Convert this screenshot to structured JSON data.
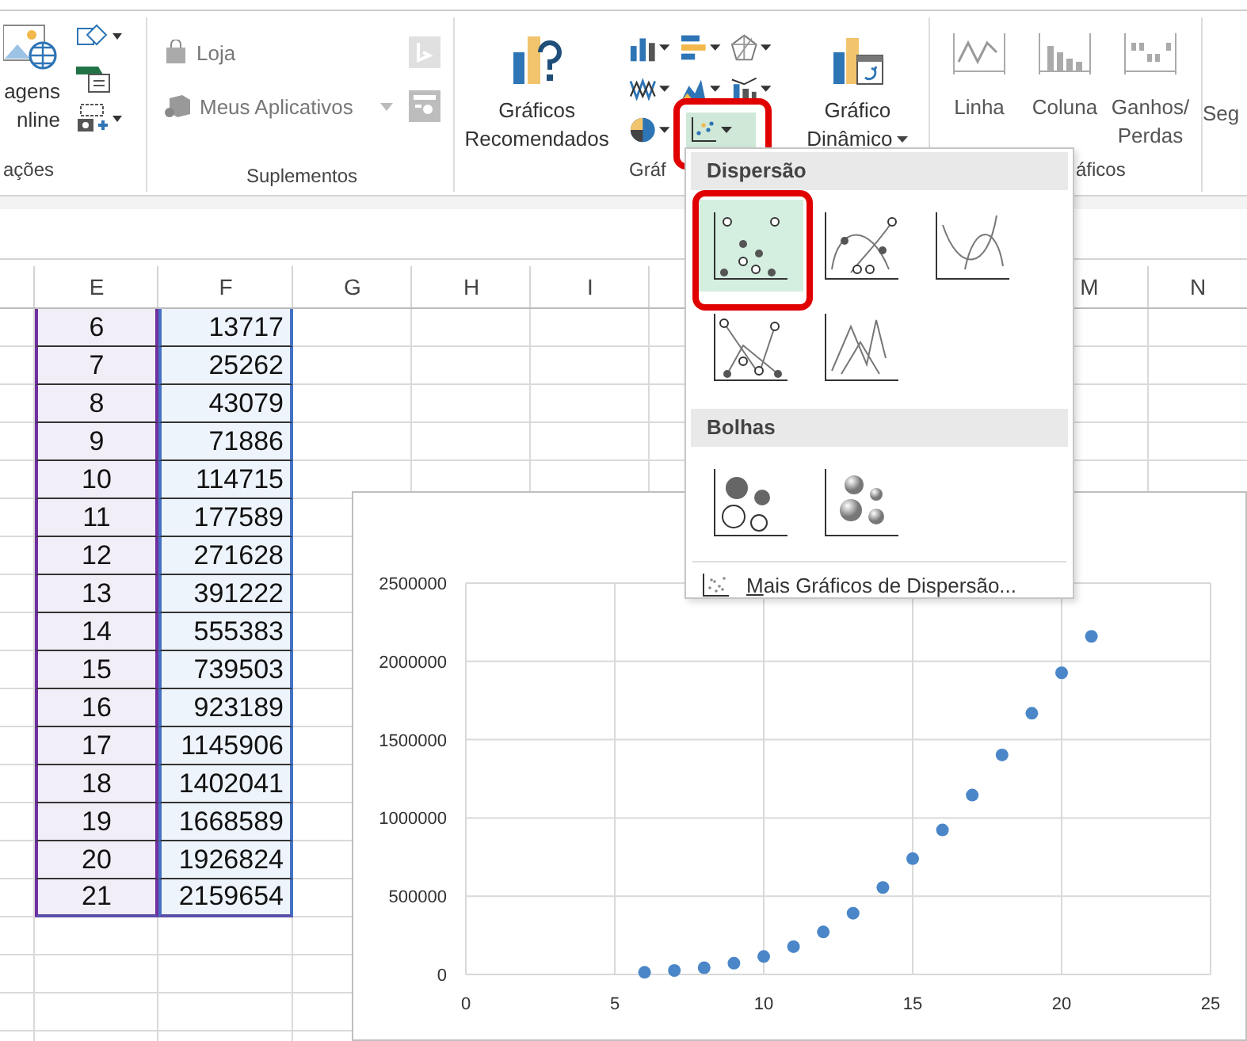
{
  "ribbon": {
    "groups": [
      {
        "kind": "illustrations",
        "label": "ações",
        "big_button": {
          "lines": [
            "agens",
            "nline"
          ]
        }
      },
      {
        "kind": "addins",
        "label": "Suplementos",
        "store": {
          "label": "Loja"
        },
        "apps": {
          "label": "Meus Aplicativos"
        }
      },
      {
        "kind": "charts",
        "label": "Gráf",
        "recommended": {
          "lines": [
            "Gráficos",
            "Recomendados"
          ]
        },
        "chart_buttons": [
          {
            "kind": "column",
            "selected": false,
            "highlighted": false
          },
          {
            "kind": "bar",
            "selected": false,
            "highlighted": false
          },
          {
            "kind": "radar",
            "selected": false,
            "highlighted": false
          },
          {
            "kind": "line",
            "selected": false,
            "highlighted": false
          },
          {
            "kind": "area",
            "selected": false,
            "highlighted": false
          },
          {
            "kind": "combo",
            "selected": false,
            "highlighted": false
          },
          {
            "kind": "pie",
            "selected": false,
            "highlighted": false
          },
          {
            "kind": "scatter",
            "selected": true,
            "highlighted": true
          }
        ],
        "pivot": {
          "lines": [
            "Gráfico",
            "Dinâmico"
          ]
        }
      },
      {
        "kind": "sparklines",
        "label": "áficos",
        "buttons": [
          {
            "kind": "line",
            "lines": [
              "Linha"
            ]
          },
          {
            "kind": "column",
            "lines": [
              "Coluna"
            ]
          },
          {
            "kind": "win-loss",
            "lines": [
              "Ganhos/",
              "Perdas"
            ]
          }
        ]
      },
      {
        "kind": "filters",
        "lines": [
          "Seg"
        ]
      }
    ]
  },
  "sheet": {
    "columns": [
      "E",
      "F",
      "G",
      "H",
      "I",
      "M",
      "N"
    ],
    "rows": [
      {
        "e": "6",
        "f": "13717"
      },
      {
        "e": "7",
        "f": "25262"
      },
      {
        "e": "8",
        "f": "43079"
      },
      {
        "e": "9",
        "f": "71886"
      },
      {
        "e": "10",
        "f": "114715"
      },
      {
        "e": "11",
        "f": "177589"
      },
      {
        "e": "12",
        "f": "271628"
      },
      {
        "e": "13",
        "f": "391222"
      },
      {
        "e": "14",
        "f": "555383"
      },
      {
        "e": "15",
        "f": "739503"
      },
      {
        "e": "16",
        "f": "923189"
      },
      {
        "e": "17",
        "f": "1145906"
      },
      {
        "e": "18",
        "f": "1402041"
      },
      {
        "e": "19",
        "f": "1668589"
      },
      {
        "e": "20",
        "f": "1926824"
      },
      {
        "e": "21",
        "f": "2159654"
      }
    ]
  },
  "chart": {
    "chart_data": {
      "type": "scatter",
      "x": [
        6,
        7,
        8,
        9,
        10,
        11,
        12,
        13,
        14,
        15,
        16,
        17,
        18,
        19,
        20,
        21
      ],
      "grid": true,
      "series": [
        {
          "color": "#4a86c8",
          "values": [
            13717,
            25262,
            43079,
            71886,
            114715,
            177589,
            271628,
            391222,
            555383,
            739503,
            923189,
            1145906,
            1402041,
            1668589,
            1926824,
            2159654
          ]
        }
      ],
      "xlim": [
        0,
        25
      ],
      "ylim": [
        0,
        2500000
      ],
      "xticks": [
        0,
        5,
        10,
        15,
        20,
        25
      ],
      "yticks": [
        0,
        500000,
        1000000,
        1500000,
        2000000,
        2500000
      ]
    }
  },
  "menu": {
    "sections": [
      {
        "title": "Dispersão",
        "options": [
          {
            "kind": "markers",
            "selected": true,
            "highlighted": true
          },
          {
            "kind": "smooth-markers",
            "selected": false,
            "highlighted": false
          },
          {
            "kind": "smooth",
            "selected": false,
            "highlighted": false
          },
          {
            "kind": "straight-markers",
            "selected": false,
            "highlighted": false
          },
          {
            "kind": "straight",
            "selected": false,
            "highlighted": false
          }
        ]
      },
      {
        "title": "Bolhas",
        "options": [
          {
            "kind": "bubble",
            "selected": false,
            "highlighted": false
          },
          {
            "kind": "bubble-3d",
            "selected": false,
            "highlighted": false
          }
        ]
      }
    ],
    "footer": {
      "label": "Mais Gráficos de Dispersão..."
    }
  }
}
